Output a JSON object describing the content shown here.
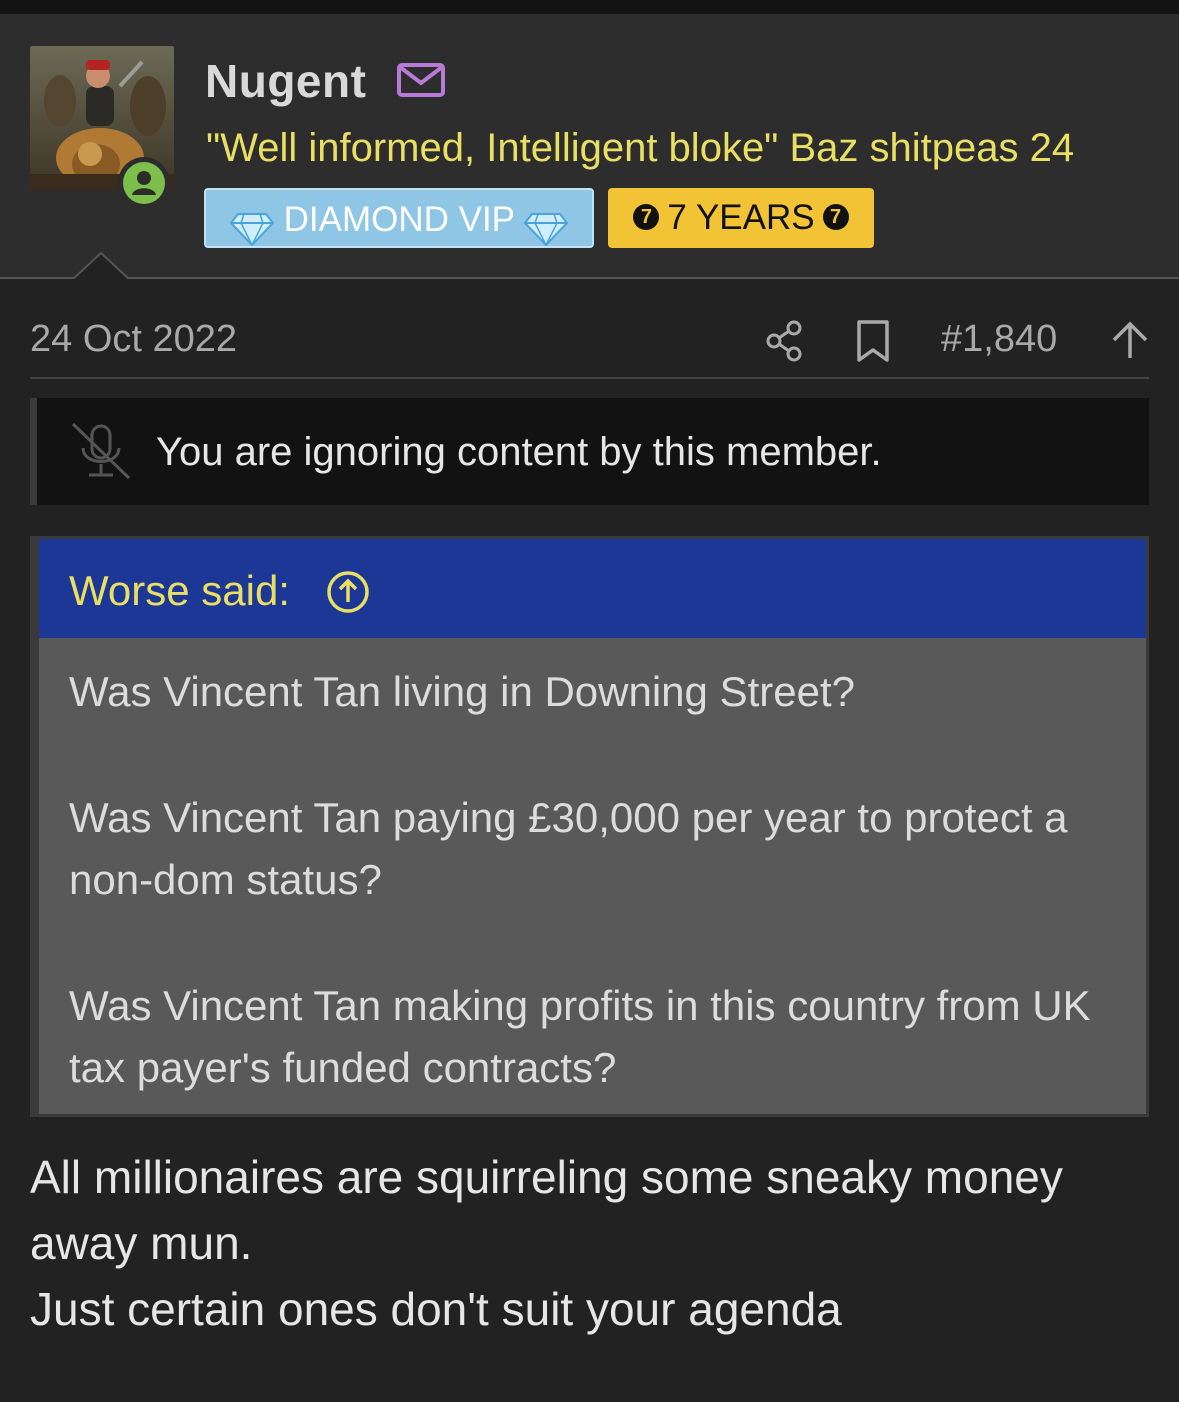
{
  "user": {
    "name": "Nugent",
    "title": "\"Well informed, Intelligent bloke\" Baz shitpeas 24",
    "badges": {
      "vip": "DIAMOND VIP",
      "years": "7 YEARS",
      "years_number": "7"
    }
  },
  "post": {
    "date": "24 Oct 2022",
    "number": "#1,840",
    "ignored_message": "You are ignoring content by this member.",
    "quote": {
      "author_line": "Worse said:",
      "paragraphs": [
        "Was Vincent Tan living in Downing Street?",
        "Was Vincent Tan paying £30,000 per year to protect a non-dom status?",
        "Was Vincent Tan making profits in this country from UK tax payer's funded contracts?"
      ]
    },
    "reply_lines": [
      "All millionaires are squirreling some sneaky money away mun.",
      "Just certain ones don't suit your agenda"
    ]
  },
  "icons": {
    "mail": "envelope-icon",
    "online": "online-user-icon",
    "gem": "diamond-icon",
    "share": "share-icon",
    "bookmark": "bookmark-icon",
    "up": "arrow-up-icon",
    "mute": "muted-microphone-icon",
    "jump": "circle-arrow-up-icon"
  },
  "colors": {
    "accent_yellow": "#e9df63",
    "quote_header": "#1d3797",
    "vip_badge": "#8fc6e6",
    "years_badge": "#f2c335",
    "online": "#7cc04b",
    "mail_icon": "#b77ad6"
  }
}
